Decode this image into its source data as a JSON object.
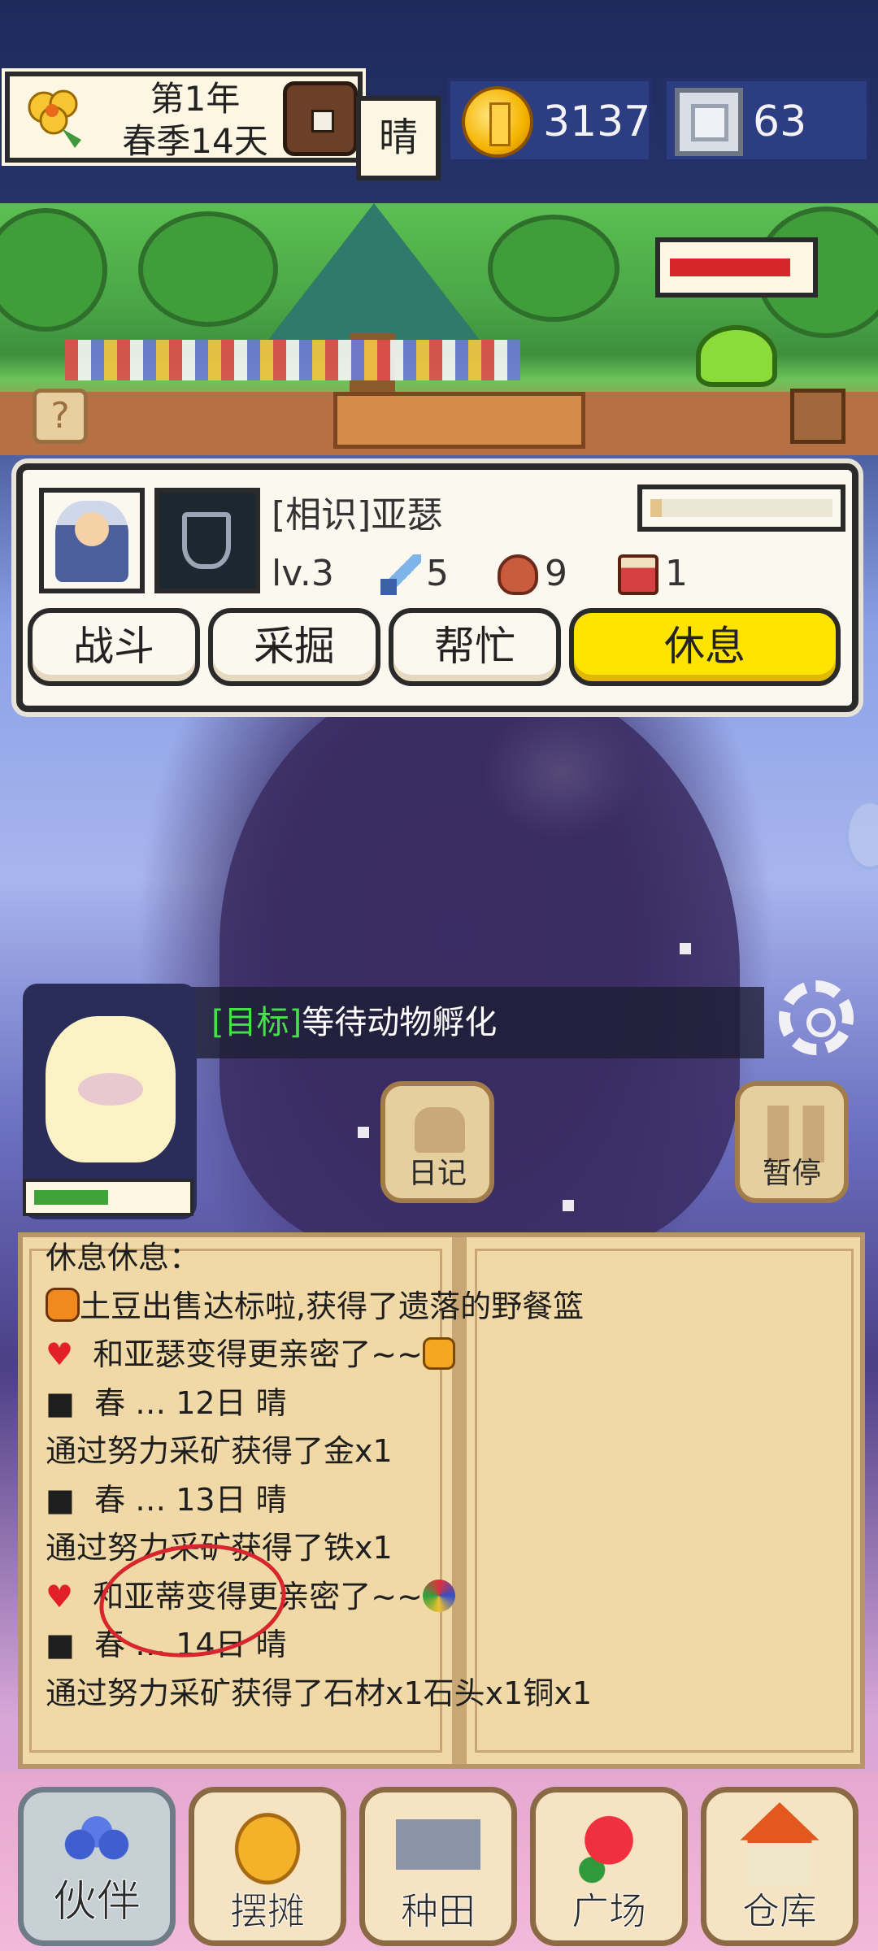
{
  "topbar": {
    "year": "第1年",
    "season_day": "春季14天",
    "weather": "晴",
    "gold": "3137",
    "silver": "63"
  },
  "garden": {
    "enemy_hp_fraction": 0.9,
    "help_label": "?"
  },
  "companion": {
    "name": "[相识]亚瑟",
    "level": "lv.3",
    "attack": "5",
    "defense": "9",
    "potion": "1",
    "exp_fraction": 0.05,
    "actions": [
      {
        "label": "战斗",
        "active": false
      },
      {
        "label": "采掘",
        "active": false
      },
      {
        "label": "帮忙",
        "active": false
      },
      {
        "label": "休息",
        "active": true
      }
    ]
  },
  "goal": {
    "tag": "[目标]",
    "text": "等待动物孵化"
  },
  "pet": {
    "bar_fraction": 0.5
  },
  "controls": {
    "diary_label": "日记",
    "pause_label": "暂停"
  },
  "log": {
    "lines": [
      {
        "icon": "",
        "text": "休息休息："
      },
      {
        "icon": "potato-emoji",
        "text": "土豆出售达标啦,获得了遗落的野餐篮"
      },
      {
        "icon": "heart",
        "text": "和亚瑟变得更亲密了~~",
        "suffix": "face-emoji"
      },
      {
        "icon": "square",
        "text": "春 … 12日 晴"
      },
      {
        "icon": "",
        "text": "通过努力采矿获得了金x1"
      },
      {
        "icon": "square",
        "text": "春 … 13日 晴"
      },
      {
        "icon": "",
        "text": "通过努力采矿获得了铁x1"
      },
      {
        "icon": "heart",
        "text": "和亚蒂变得更亲密了~~",
        "suffix": "fan-emoji"
      },
      {
        "icon": "square",
        "text": "春 … 14日 晴"
      },
      {
        "icon": "",
        "text": "通过努力采矿获得了石材x1石头x1铜x1"
      }
    ]
  },
  "nav": {
    "items": [
      {
        "label": "伙伴",
        "icon": "team-icon",
        "selected": true
      },
      {
        "label": "摆摊",
        "icon": "stall-icon",
        "selected": false
      },
      {
        "label": "种田",
        "icon": "farm-icon",
        "selected": false
      },
      {
        "label": "广场",
        "icon": "plaza-icon",
        "selected": false
      },
      {
        "label": "仓库",
        "icon": "house-icon",
        "selected": false
      }
    ]
  }
}
